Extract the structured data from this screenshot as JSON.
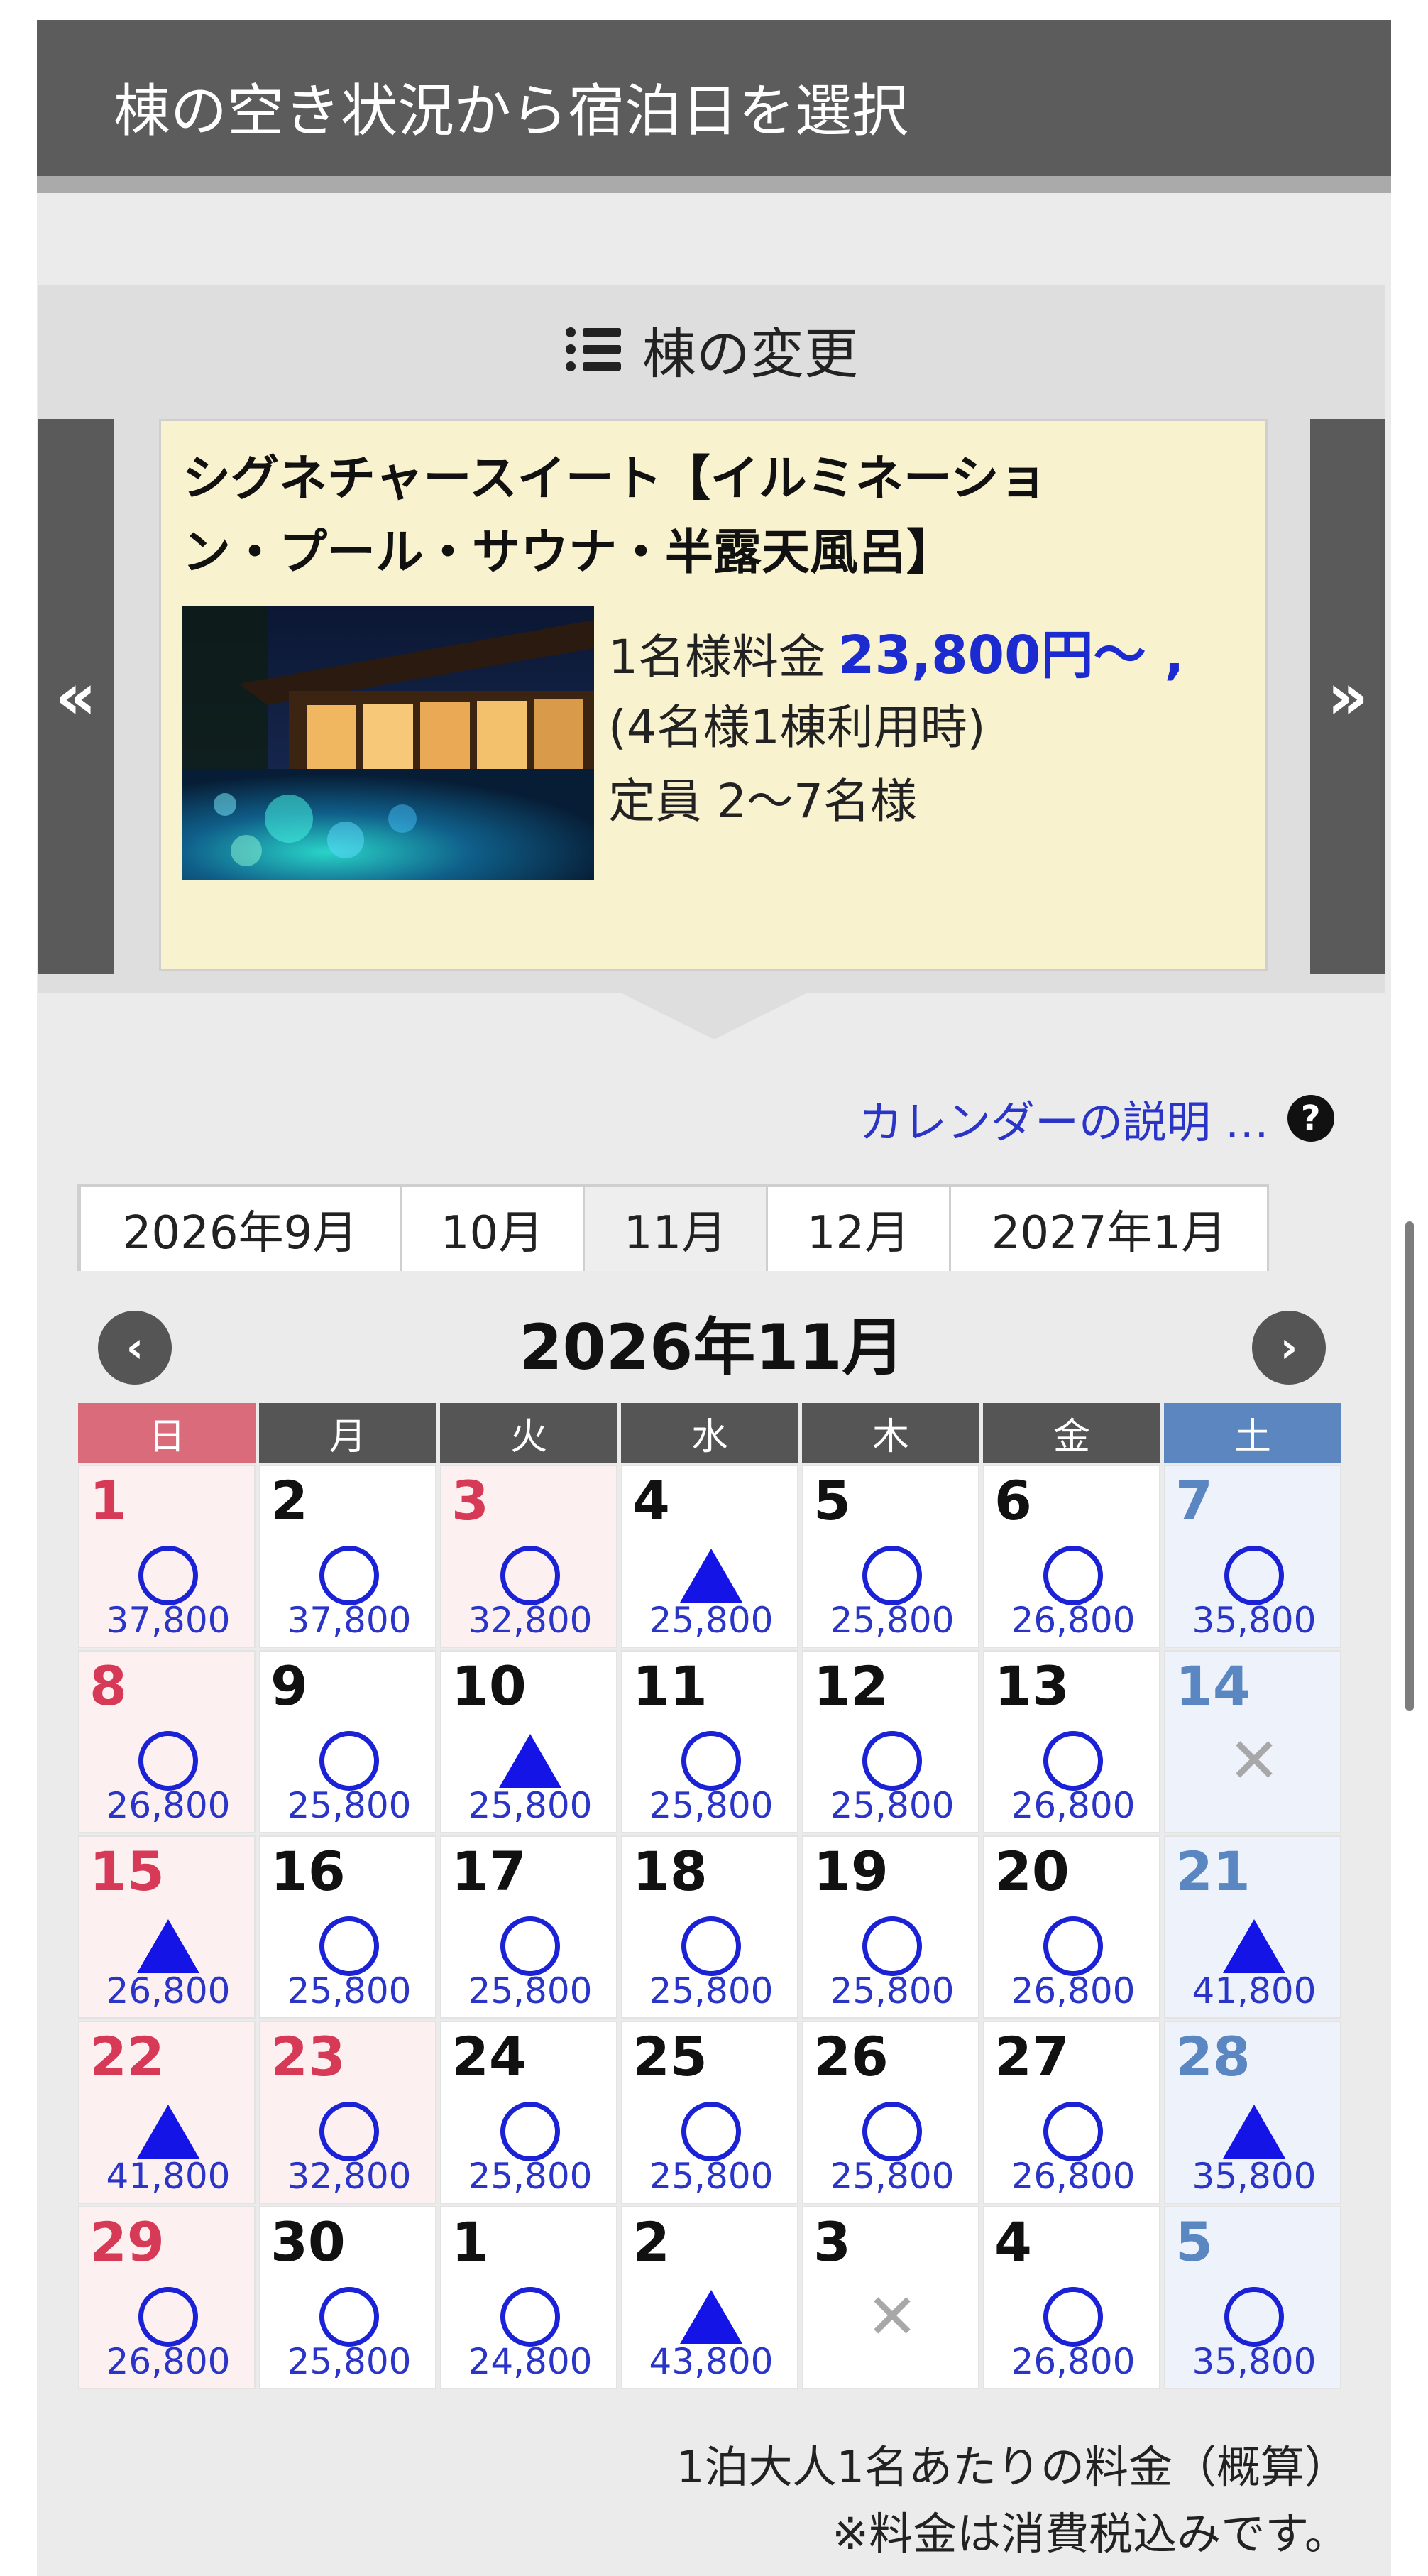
{
  "header": {
    "title": "棟の空き状況から宿泊日を選択"
  },
  "room_change": {
    "label": "棟の変更",
    "prev_label": "«",
    "next_label": "»"
  },
  "room": {
    "title": "シグネチャースイート【イルミネーション・プール・サウナ・半露天風呂】",
    "price_label": "1名様料金",
    "price_value": "23,800円〜 ,",
    "usage": "(4名様1棟利用時)",
    "capacity": "定員 2〜7名様"
  },
  "legend": {
    "label": "カレンダーの説明 …",
    "help_icon": "?"
  },
  "month_tabs": [
    {
      "label": "2026年9月",
      "active": false
    },
    {
      "label": "10月",
      "active": false
    },
    {
      "label": "11月",
      "active": true
    },
    {
      "label": "12月",
      "active": false
    },
    {
      "label": "2027年1月",
      "active": false
    }
  ],
  "calendar": {
    "title": "2026年11月",
    "prev_icon": "‹",
    "next_icon": "›",
    "weekdays": [
      "日",
      "月",
      "火",
      "水",
      "木",
      "金",
      "土"
    ],
    "weeks": [
      [
        {
          "day": "1",
          "mark": "circle",
          "price": "37,800",
          "type": "sun"
        },
        {
          "day": "2",
          "mark": "circle",
          "price": "37,800",
          "type": ""
        },
        {
          "day": "3",
          "mark": "circle",
          "price": "32,800",
          "type": "hol"
        },
        {
          "day": "4",
          "mark": "triangle",
          "price": "25,800",
          "type": ""
        },
        {
          "day": "5",
          "mark": "circle",
          "price": "25,800",
          "type": ""
        },
        {
          "day": "6",
          "mark": "circle",
          "price": "26,800",
          "type": ""
        },
        {
          "day": "7",
          "mark": "circle",
          "price": "35,800",
          "type": "sat"
        }
      ],
      [
        {
          "day": "8",
          "mark": "circle",
          "price": "26,800",
          "type": "sun"
        },
        {
          "day": "9",
          "mark": "circle",
          "price": "25,800",
          "type": ""
        },
        {
          "day": "10",
          "mark": "triangle",
          "price": "25,800",
          "type": ""
        },
        {
          "day": "11",
          "mark": "circle",
          "price": "25,800",
          "type": ""
        },
        {
          "day": "12",
          "mark": "circle",
          "price": "25,800",
          "type": ""
        },
        {
          "day": "13",
          "mark": "circle",
          "price": "26,800",
          "type": ""
        },
        {
          "day": "14",
          "mark": "cross",
          "price": "",
          "type": "sat"
        }
      ],
      [
        {
          "day": "15",
          "mark": "triangle",
          "price": "26,800",
          "type": "sun"
        },
        {
          "day": "16",
          "mark": "circle",
          "price": "25,800",
          "type": ""
        },
        {
          "day": "17",
          "mark": "circle",
          "price": "25,800",
          "type": ""
        },
        {
          "day": "18",
          "mark": "circle",
          "price": "25,800",
          "type": ""
        },
        {
          "day": "19",
          "mark": "circle",
          "price": "25,800",
          "type": ""
        },
        {
          "day": "20",
          "mark": "circle",
          "price": "26,800",
          "type": ""
        },
        {
          "day": "21",
          "mark": "triangle",
          "price": "41,800",
          "type": "sat"
        }
      ],
      [
        {
          "day": "22",
          "mark": "triangle",
          "price": "41,800",
          "type": "sun"
        },
        {
          "day": "23",
          "mark": "circle",
          "price": "32,800",
          "type": "hol"
        },
        {
          "day": "24",
          "mark": "circle",
          "price": "25,800",
          "type": ""
        },
        {
          "day": "25",
          "mark": "circle",
          "price": "25,800",
          "type": ""
        },
        {
          "day": "26",
          "mark": "circle",
          "price": "25,800",
          "type": ""
        },
        {
          "day": "27",
          "mark": "circle",
          "price": "26,800",
          "type": ""
        },
        {
          "day": "28",
          "mark": "triangle",
          "price": "35,800",
          "type": "sat"
        }
      ],
      [
        {
          "day": "29",
          "mark": "circle",
          "price": "26,800",
          "type": "sun"
        },
        {
          "day": "30",
          "mark": "circle",
          "price": "25,800",
          "type": ""
        },
        {
          "day": "1",
          "mark": "circle",
          "price": "24,800",
          "type": ""
        },
        {
          "day": "2",
          "mark": "triangle",
          "price": "43,800",
          "type": ""
        },
        {
          "day": "3",
          "mark": "cross",
          "price": "",
          "type": ""
        },
        {
          "day": "4",
          "mark": "circle",
          "price": "26,800",
          "type": ""
        },
        {
          "day": "5",
          "mark": "circle",
          "price": "35,800",
          "type": "sat"
        }
      ]
    ]
  },
  "footer": {
    "line1": "1泊大人1名あたりの料金（概算）",
    "line2": "※料金は消費税込みです。"
  },
  "colors": {
    "header_bg": "#5c5c5c",
    "sunday": "#d63a57",
    "saturday": "#5a86c2",
    "availability_mark": "#1b22d6",
    "price_text": "#2a35c8"
  },
  "icons": {
    "list": "list-icon",
    "help": "help-icon",
    "prev_room": "double-chevron-left-icon",
    "next_room": "double-chevron-right-icon",
    "prev_month": "chevron-left-icon",
    "next_month": "chevron-right-icon",
    "available": "circle-mark-icon",
    "few_left": "triangle-mark-icon",
    "full": "cross-mark-icon"
  }
}
